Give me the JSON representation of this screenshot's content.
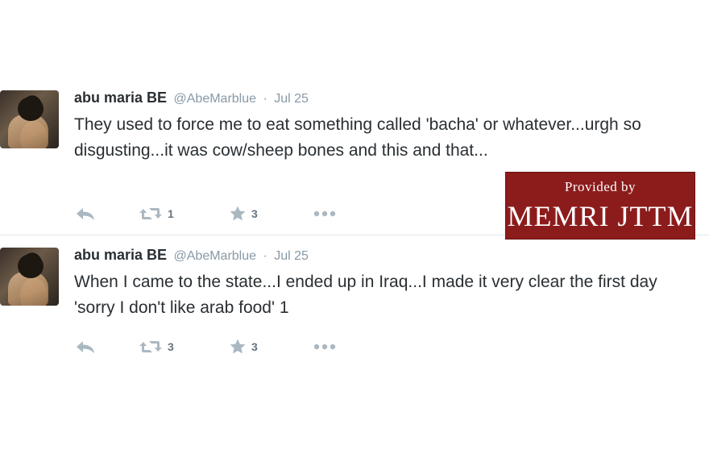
{
  "tweets": [
    {
      "name": "abu maria BE",
      "handle": "@AbeMarblue",
      "separator": "·",
      "date": "Jul 25",
      "text": "They used to force me to eat something called 'bacha' or whatever...urgh so disgusting...it was cow/sheep bones and this and that...",
      "retweets": "1",
      "favorites": "3"
    },
    {
      "name": "abu maria BE",
      "handle": "@AbeMarblue",
      "separator": "·",
      "date": "Jul 25",
      "text": "When I came to the state...I ended up in Iraq...I made it very clear the first day 'sorry I don't like arab food' 1",
      "retweets": "3",
      "favorites": "3"
    }
  ],
  "watermark": {
    "line1": "Provided by",
    "line2": "MEMRI JTTM"
  },
  "icons": {
    "reply": "reply-icon",
    "retweet": "retweet-icon",
    "favorite": "star-icon",
    "more": "more-icon"
  },
  "colors": {
    "watermark_bg": "#8c1c1c",
    "text": "#292f33",
    "muted": "#8899a6",
    "icon": "#aab8c2"
  }
}
